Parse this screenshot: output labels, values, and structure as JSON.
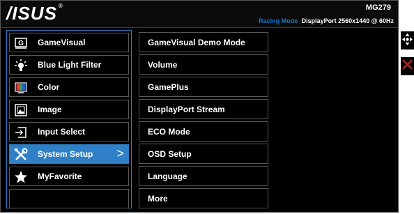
{
  "header": {
    "brand": "/ISUS",
    "brand_mark": "®",
    "model": "MG279",
    "mode": "Racing Mode",
    "signal": "DisplayPort 2560x1440 @ 60Hz"
  },
  "main_menu": {
    "items": [
      {
        "label": "GameVisual",
        "icon": "gamevisual-icon"
      },
      {
        "label": "Blue Light Filter",
        "icon": "blue-light-filter-icon"
      },
      {
        "label": "Color",
        "icon": "color-icon"
      },
      {
        "label": "Image",
        "icon": "image-icon"
      },
      {
        "label": "Input Select",
        "icon": "input-select-icon"
      },
      {
        "label": "System Setup",
        "icon": "wrench-screwdriver-icon",
        "selected": true
      },
      {
        "label": "MyFavorite",
        "icon": "star-icon"
      }
    ],
    "selected_chevron": ">",
    "accent_color": "#2f80c6"
  },
  "submenu": {
    "items": [
      "GameVisual Demo Mode",
      "Volume",
      "GamePlus",
      "DisplayPort Stream",
      "ECO Mode",
      "OSD Setup",
      "Language",
      "More"
    ]
  },
  "side_buttons": {
    "move": "move-arrows-icon",
    "close": "close-icon",
    "close_color": "#e02020"
  }
}
